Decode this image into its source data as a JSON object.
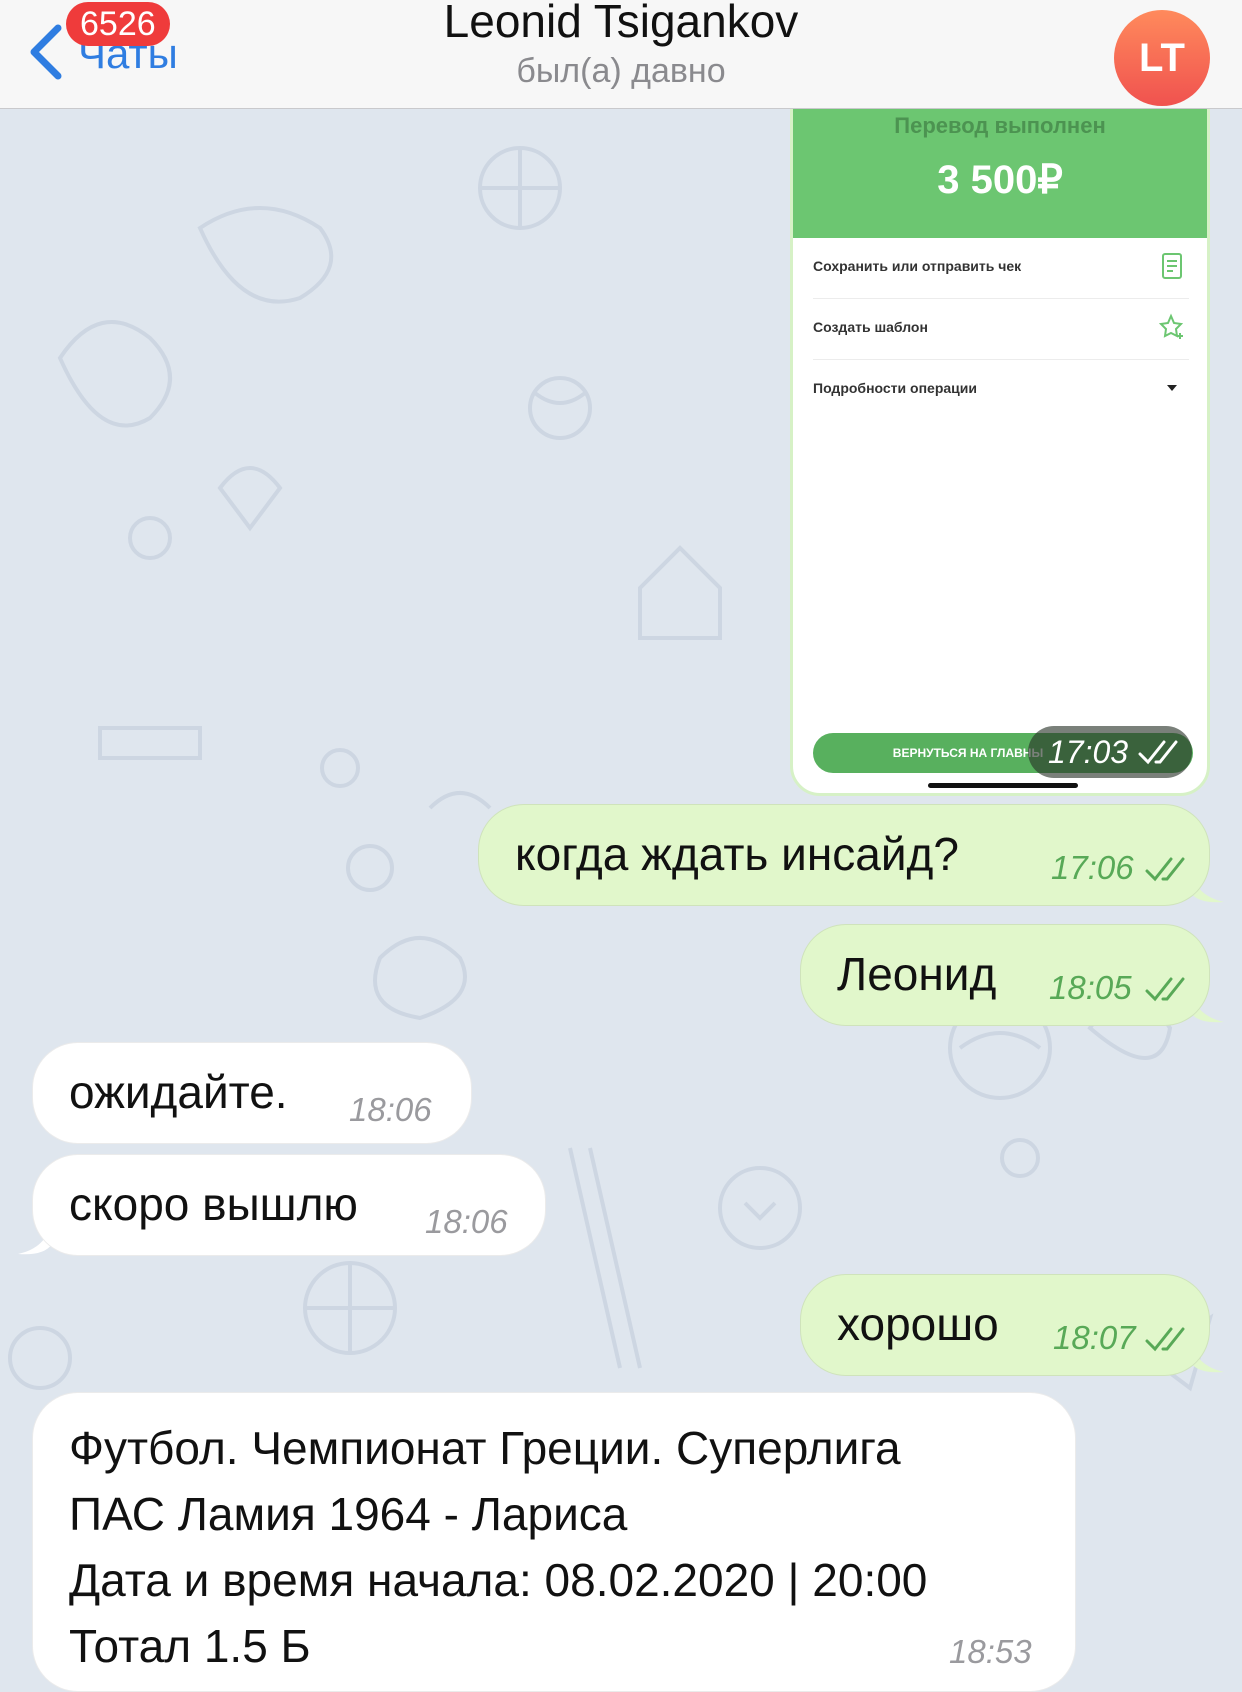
{
  "header": {
    "back_label": "Чаты",
    "unread_badge": "6526",
    "title": "Leonid Tsigankov",
    "subtitle": "был(а) давно",
    "avatar_initials": "LT"
  },
  "screenshot_message": {
    "status": "Перевод выполнен",
    "amount": "3 500₽",
    "rows": [
      {
        "label": "Сохранить или отправить чек",
        "icon": "receipt-icon"
      },
      {
        "label": "Создать шаблон",
        "icon": "star-plus-icon"
      },
      {
        "label": "Подробности операции",
        "icon": "dropdown-arrow-icon"
      }
    ],
    "button_label": "ВЕРНУТЬСЯ НА ГЛАВНЫ",
    "time": "17:03"
  },
  "messages": [
    {
      "text": "когда ждать инсайд?",
      "time": "17:06",
      "direction": "outgoing"
    },
    {
      "text": "Леонид",
      "time": "18:05",
      "direction": "outgoing"
    },
    {
      "text": "ожидайте.",
      "time": "18:06",
      "direction": "incoming"
    },
    {
      "text": "скоро вышлю",
      "time": "18:06",
      "direction": "incoming"
    },
    {
      "text": "хорошо",
      "time": "18:07",
      "direction": "outgoing"
    }
  ],
  "long_message": {
    "lines": [
      "Футбол. Чемпионат Греции. Суперлига",
      "ПАС Ламия 1964 - Лариса",
      "Дата и время начала: 08.02.2020 | 20:00",
      "Тотал 1.5 Б"
    ],
    "time": "18:53"
  },
  "colors": {
    "outgoing_bubble": "#e1f7cb",
    "incoming_bubble": "#ffffff",
    "accent_blue": "#2f7de1",
    "badge_red": "#ef3b3b",
    "chat_background": "#dfe6ee"
  }
}
